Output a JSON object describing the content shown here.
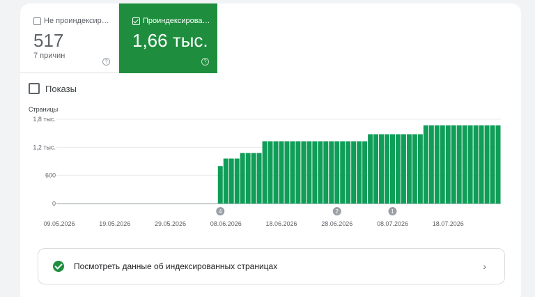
{
  "tiles": {
    "not_indexed": {
      "label": "Не проиндексир…",
      "value": "517",
      "sub": "7 причин",
      "help": "?"
    },
    "indexed": {
      "label": "Проиндексирова…",
      "value": "1,66 тыс.",
      "help": "?"
    }
  },
  "impressions_label": "Показы",
  "footer": {
    "label": "Посмотреть данные об индексированных страницах",
    "chevron": "›"
  },
  "colors": {
    "accent": "#1e8e3e",
    "bar": "#0f9d58"
  },
  "chart_data": {
    "type": "bar",
    "ylabel": "Страницы",
    "ylim": [
      0,
      1800
    ],
    "yticks": [
      {
        "value": 0,
        "label": "0"
      },
      {
        "value": 600,
        "label": "600"
      },
      {
        "value": 1200,
        "label": "1,2 тыс."
      },
      {
        "value": 1800,
        "label": "1,8 тыс."
      }
    ],
    "xtick_labels": [
      "09.05.2026",
      "19.05.2026",
      "29.05.2026",
      "08.06.2026",
      "18.06.2026",
      "28.06.2026",
      "08.07.2026",
      "18.07.2026"
    ],
    "start_date": "2026-05-09",
    "values": [
      0,
      0,
      0,
      0,
      0,
      0,
      0,
      0,
      0,
      0,
      0,
      0,
      0,
      0,
      0,
      0,
      0,
      0,
      0,
      0,
      0,
      0,
      0,
      0,
      0,
      0,
      0,
      0,
      0,
      800,
      960,
      960,
      960,
      1080,
      1080,
      1080,
      1080,
      1330,
      1330,
      1330,
      1330,
      1330,
      1330,
      1330,
      1330,
      1330,
      1330,
      1330,
      1330,
      1330,
      1330,
      1330,
      1330,
      1330,
      1330,
      1330,
      1480,
      1480,
      1480,
      1480,
      1480,
      1480,
      1480,
      1480,
      1480,
      1480,
      1670,
      1670,
      1670,
      1670,
      1670,
      1670,
      1670,
      1670,
      1670,
      1670,
      1670,
      1670,
      1670,
      1670
    ],
    "annotations": [
      {
        "date": "07.06.2026",
        "label": "4"
      },
      {
        "date": "28.06.2026",
        "label": "2"
      },
      {
        "date": "08.07.2026",
        "label": "1"
      }
    ]
  }
}
